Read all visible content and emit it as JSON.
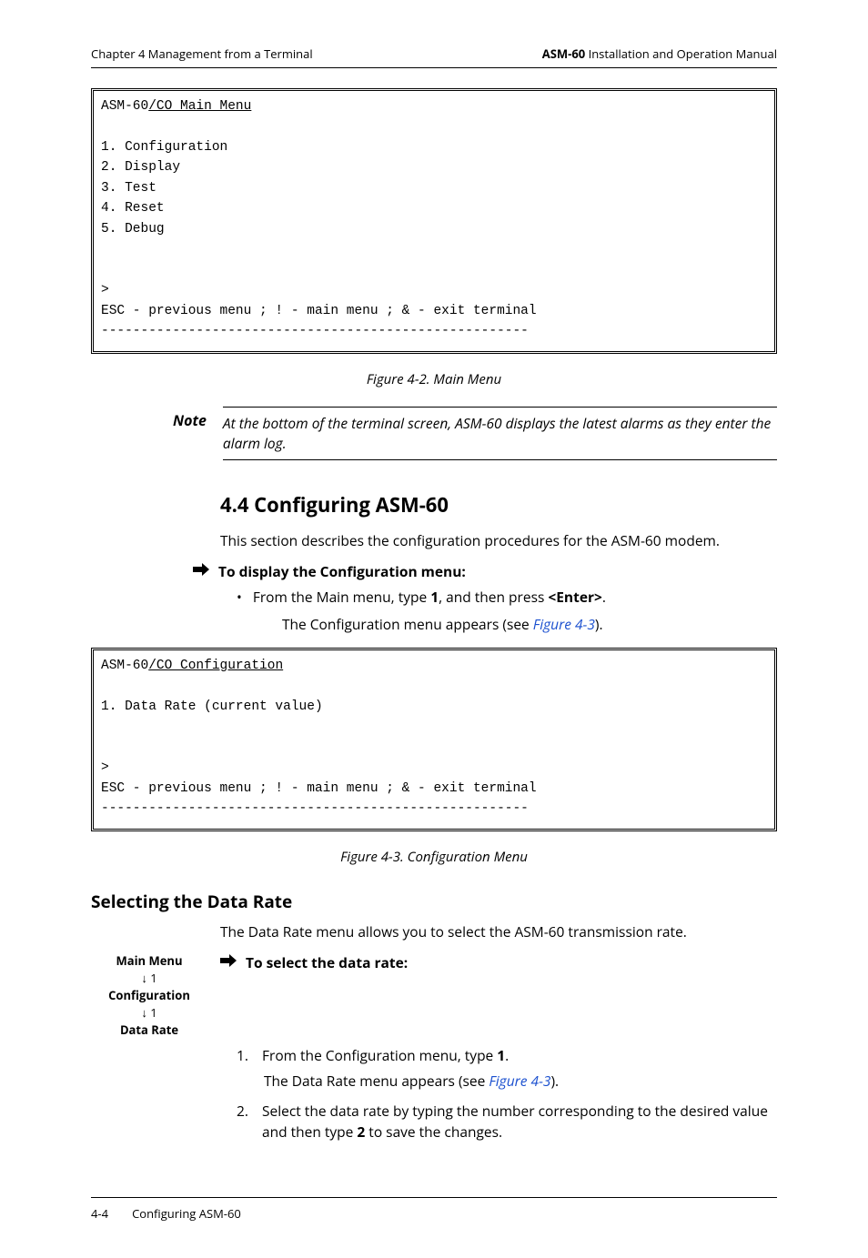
{
  "header": {
    "left": "Chapter 4  Management from a Terminal",
    "right_bold": "ASM-60",
    "right_rest": " Installation and Operation Manual"
  },
  "terminal1": {
    "title_prefix": "ASM-60",
    "title_suffix": "/CO Main Menu",
    "items": [
      "1. Configuration",
      "2. Display",
      "3. Test",
      "4. Reset",
      "5. Debug"
    ],
    "prompt": ">",
    "hint": "ESC - previous menu ; ! - main menu ; & - exit terminal",
    "rule": "------------------------------------------------------"
  },
  "fig42": "Figure 4-2.  Main Menu",
  "note": {
    "label": "Note",
    "text": "At the bottom of the terminal screen, ASM-60 displays the latest alarms as they enter the alarm log."
  },
  "sec44": {
    "heading": "4.4  Configuring ASM-60",
    "intro": "This section describes the configuration procedures for the ASM-60 modem.",
    "proc_head": "To display the Configuration menu:",
    "bullet_a": "From the Main menu, type ",
    "bullet_b": "1",
    "bullet_c": ", and then press ",
    "bullet_d": "<Enter>",
    "bullet_e": ".",
    "sub_a": "The Configuration menu appears (see ",
    "sub_link": "Figure 4-3",
    "sub_b": ")."
  },
  "terminal2": {
    "title_prefix": "ASM-60",
    "title_suffix": "/CO Configuration",
    "item1": "1. Data Rate (current value)",
    "prompt": ">",
    "hint": "ESC - previous menu ; ! - main menu ; & - exit terminal",
    "rule": "------------------------------------------------------"
  },
  "fig43": "Figure 4-3.  Configuration Menu",
  "datarate": {
    "heading": "Selecting the Data Rate",
    "intro": "The Data Rate menu allows you to select the ASM-60 transmission rate.",
    "nav_line1": "Main Menu",
    "nav_down1": "↓ 1",
    "nav_line2": "Configuration",
    "nav_down2": "↓ 1",
    "nav_line3": "Data Rate",
    "proc_head": "To select the data rate:",
    "step1_a": "From the Configuration menu, type ",
    "step1_b": "1",
    "step1_c": ".",
    "step1_sub_a": "The Data Rate menu appears (see ",
    "step1_sub_link": "Figure 4-3",
    "step1_sub_b": ").",
    "step2_a": "Select the data rate by typing the number corresponding to the desired value and then type ",
    "step2_b": "2",
    "step2_c": " to save the changes."
  },
  "footer": {
    "page": "4-4",
    "title": "Configuring ASM-60"
  }
}
